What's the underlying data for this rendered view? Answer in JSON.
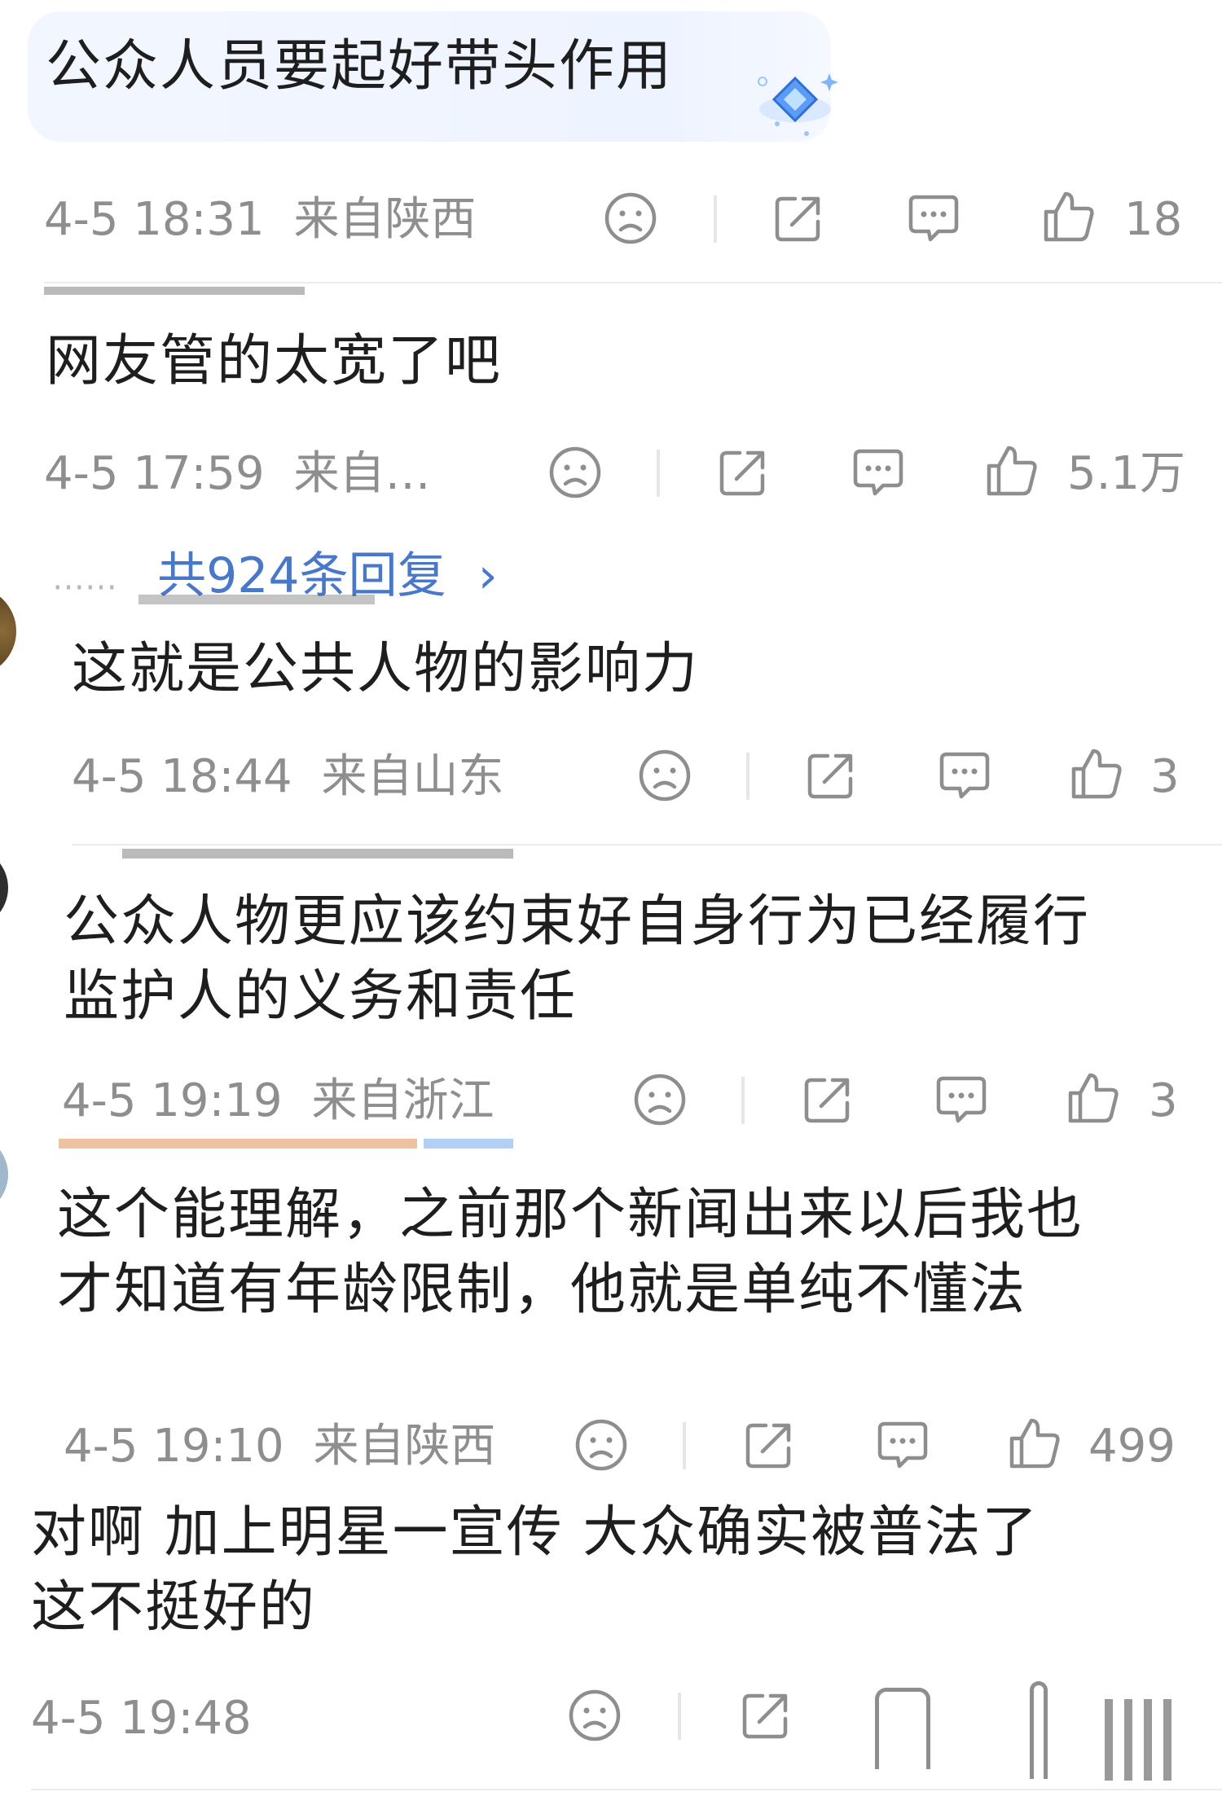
{
  "comments": [
    {
      "text_lines": [
        "公众人员要起好带头作用"
      ],
      "time": "4-5 18:31",
      "location": "来自陕西",
      "likes": "18"
    },
    {
      "text_lines": [
        "网友管的太宽了吧"
      ],
      "time": "4-5 17:59",
      "location": "来自…",
      "likes": "5.1万"
    },
    {
      "text_lines": [
        "这就是公共人物的影响力"
      ],
      "time": "4-5 18:44",
      "location": "来自山东",
      "likes": "3"
    },
    {
      "text_lines": [
        "公众人物更应该约束好自身行为已经履行",
        "监护人的义务和责任"
      ],
      "time": "4-5 19:19",
      "location": "来自浙江",
      "likes": "3"
    },
    {
      "text_lines": [
        "这个能理解，之前那个新闻出来以后我也",
        "才知道有年龄限制，他就是单纯不懂法"
      ],
      "time": "4-5 19:10",
      "location": "来自陕西",
      "likes": "499"
    },
    {
      "text_lines": [
        "对啊 加上明星一宣传 大众确实被普法了",
        "这不挺好的"
      ],
      "time": "4-5 19:48",
      "location": "",
      "likes": ""
    }
  ],
  "reply_link": {
    "dots": "……",
    "label": "共924条回复",
    "arrow": "›"
  },
  "icons": {
    "dislike": "sad-face-icon",
    "share": "share-icon",
    "comment": "comment-icon",
    "like": "thumbs-up-icon"
  },
  "colors": {
    "meta_gray": "#8e8e8e",
    "link_blue": "#4a78c9",
    "bubble_bg": "#eef4ff"
  }
}
